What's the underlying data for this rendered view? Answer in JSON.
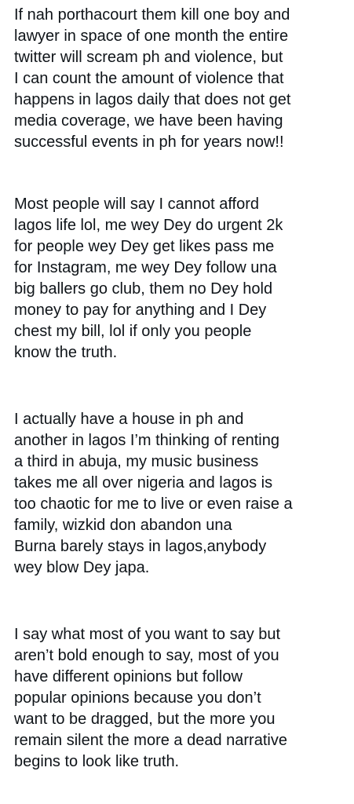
{
  "tweet": {
    "paragraphs": [
      "If nah porthacourt them kill one boy and\nlawyer in space of one month the entire\ntwitter will scream ph and violence, but\nI can count the amount of violence that\nhappens in lagos daily that does not get\nmedia coverage, we have been having\nsuccessful events in ph for years now!!",
      "Most people will say I cannot afford\nlagos life lol, me wey Dey do urgent 2k\nfor people wey Dey get likes pass me\nfor Instagram, me wey Dey follow una\nbig ballers go club, them no Dey hold\nmoney to pay for anything and I Dey\nchest my bill, lol if only you people\nknow the truth.",
      "I actually have a house in ph and\nanother in lagos I’m thinking of renting\na third in abuja, my music business\ntakes me all over nigeria and lagos is\ntoo chaotic for me to live or even raise a\nfamily,  wizkid don abandon una\nBurna barely stays in lagos,anybody\nwey blow Dey japa.",
      "I say what most of you want to say but\naren’t bold enough to say, most of you\nhave different opinions but follow\npopular opinions because you don’t\nwant to be dragged, but the more you\nremain silent the more a dead narrative\nbegins to look like truth."
    ]
  },
  "colors": {
    "background": "#ffffff",
    "text": "#0f1419"
  }
}
